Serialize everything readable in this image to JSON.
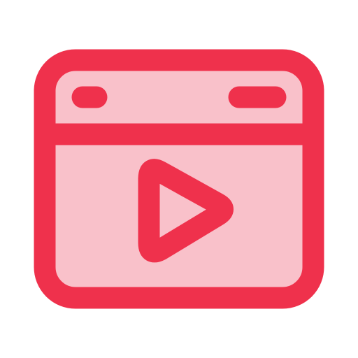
{
  "icon": {
    "name": "video-player-window-icon",
    "colors": {
      "stroke": "#EF314C",
      "fill": "#F9C1CA",
      "background": "#FFFFFF"
    },
    "parts": {
      "window_frame": "window-frame",
      "title_bar": "title-bar",
      "left_pill": "title-bar-left-pill",
      "right_pill": "title-bar-right-pill",
      "content_area": "content-area",
      "play_button": "play-icon"
    }
  }
}
